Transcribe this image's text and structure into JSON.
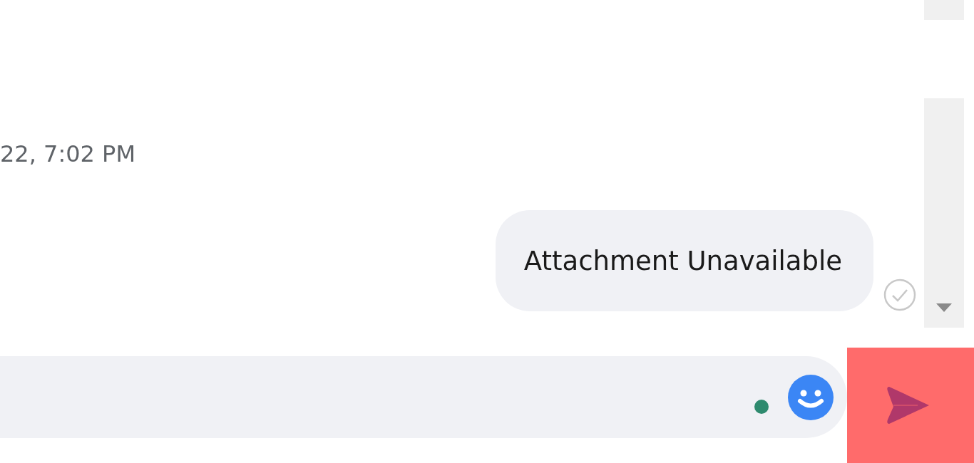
{
  "timestamp": "22, 7:02 PM",
  "messages": [
    {
      "text": "Attachment Unavailable",
      "outgoing": true
    }
  ]
}
